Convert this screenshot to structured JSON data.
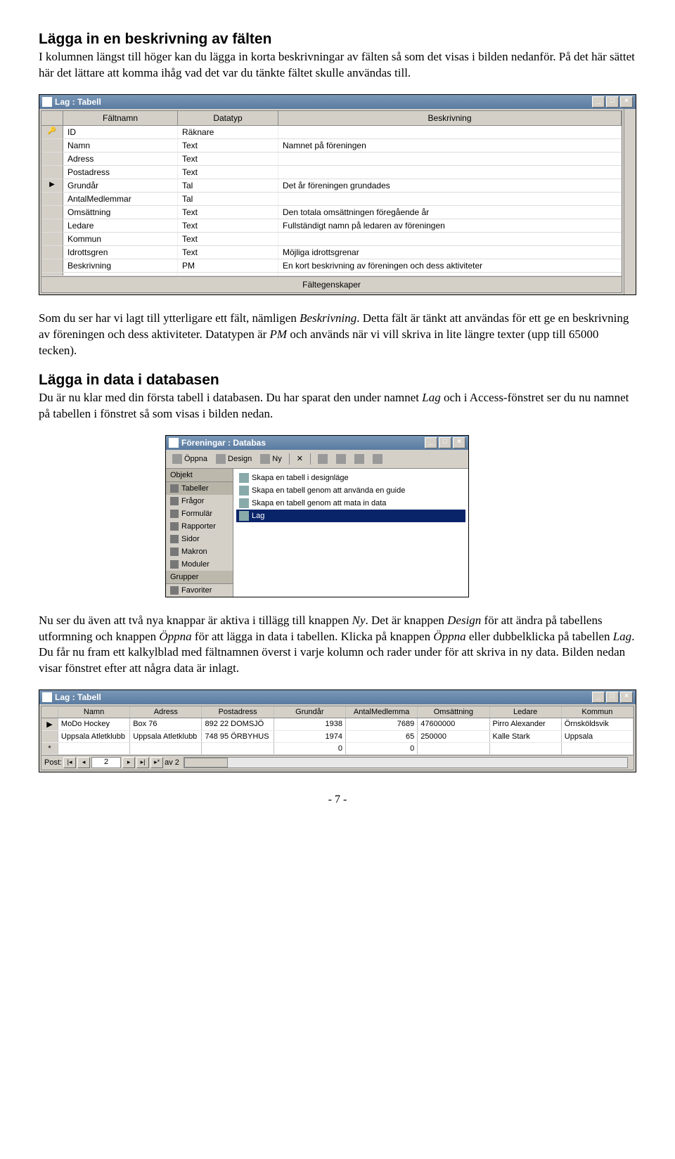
{
  "section1": {
    "heading": "Lägga in en beskrivning av fälten",
    "para": "I kolumnen längst till höger kan du lägga in korta beskrivningar av fälten så som det visas i bilden nedanför. På det här sättet här det lättare att komma ihåg vad det var du tänkte fältet skulle användas till."
  },
  "designWin": {
    "title": "Lag : Tabell",
    "headers": {
      "name": "Fältnamn",
      "type": "Datatyp",
      "desc": "Beskrivning"
    },
    "rows": [
      {
        "sel": "🔑",
        "name": "ID",
        "type": "Räknare",
        "desc": ""
      },
      {
        "sel": "",
        "name": "Namn",
        "type": "Text",
        "desc": "Namnet på föreningen"
      },
      {
        "sel": "",
        "name": "Adress",
        "type": "Text",
        "desc": ""
      },
      {
        "sel": "",
        "name": "Postadress",
        "type": "Text",
        "desc": ""
      },
      {
        "sel": "▶",
        "name": "Grundår",
        "type": "Tal",
        "desc": "Det år föreningen grundades"
      },
      {
        "sel": "",
        "name": "AntalMedlemmar",
        "type": "Tal",
        "desc": ""
      },
      {
        "sel": "",
        "name": "Omsättning",
        "type": "Text",
        "desc": "Den totala omsättningen föregående år"
      },
      {
        "sel": "",
        "name": "Ledare",
        "type": "Text",
        "desc": "Fullständigt namn på ledaren av föreningen"
      },
      {
        "sel": "",
        "name": "Kommun",
        "type": "Text",
        "desc": ""
      },
      {
        "sel": "",
        "name": "Idrottsgren",
        "type": "Text",
        "desc": "Möjliga idrottsgrenar"
      },
      {
        "sel": "",
        "name": "Beskrivning",
        "type": "PM",
        "desc": "En kort beskrivning av föreningen och dess aktiviteter"
      },
      {
        "sel": "",
        "name": "",
        "type": "",
        "desc": ""
      }
    ],
    "footer": "Fältegenskaper"
  },
  "midpara": "Som du ser har vi lagt till ytterligare ett fält, nämligen <em>Beskrivning</em>. Detta fält är tänkt att användas för ett ge en beskrivning av föreningen och dess aktiviteter. Datatypen är <em>PM</em> och används när vi vill skriva in lite längre texter (upp till 65000 tecken).",
  "section2": {
    "heading": "Lägga in data i databasen",
    "para": "Du är nu klar med din första tabell i databasen. Du har sparat den under namnet <em>Lag</em> och i Access-fönstret ser du nu namnet på tabellen i fönstret så som visas i bilden nedan."
  },
  "dbWin": {
    "title": "Föreningar : Databas",
    "toolbar": {
      "open": "Öppna",
      "design": "Design",
      "new": "Ny"
    },
    "objheader": "Objekt",
    "objects": [
      "Tabeller",
      "Frågor",
      "Formulär",
      "Rapporter",
      "Sidor",
      "Makron",
      "Moduler"
    ],
    "grpheader": "Grupper",
    "groups": [
      "Favoriter"
    ],
    "listitems": [
      "Skapa en tabell i designläge",
      "Skapa en tabell genom att använda en guide",
      "Skapa en tabell genom att mata in data"
    ],
    "selected": "Lag"
  },
  "para3": "Nu ser du även att två nya knappar är aktiva i tillägg till knappen <em>Ny</em>. Det är knappen <em>Design</em> för att ändra på tabellens utformning och knappen <em>Öppna</em> för att lägga in data i tabellen. Klicka på knappen <em>Öppna</em> eller dubbelklicka på tabellen <em>Lag</em>. Du får nu fram ett kalkylblad med fältnamnen överst i varje kolumn och rader under för att skriva in ny data. Bilden nedan visar fönstret efter att några data är inlagt.",
  "dsWin": {
    "title": "Lag : Tabell",
    "headers": [
      "Namn",
      "Adress",
      "Postadress",
      "Grundår",
      "AntalMedlemma",
      "Omsättning",
      "Ledare",
      "Kommun"
    ],
    "rows": [
      {
        "sel": "▶",
        "cells": [
          "MoDo Hockey",
          "Box 76",
          "892 22  DOMSJÖ",
          "1938",
          "7689",
          "47600000",
          "Pirro Alexander",
          "Örnsköldsvik"
        ]
      },
      {
        "sel": "",
        "cells": [
          "Uppsala Atletklubb",
          "Uppsala Atletklubb",
          "748 95  ÖRBYHUS",
          "1974",
          "65",
          "250000",
          "Kalle Stark",
          "Uppsala"
        ]
      },
      {
        "sel": "*",
        "cells": [
          "",
          "",
          "",
          "0",
          "0",
          "",
          "",
          ""
        ]
      }
    ],
    "nav": {
      "label": "Post:",
      "value": "2",
      "of": "av 2"
    }
  },
  "pagenum": "- 7 -"
}
